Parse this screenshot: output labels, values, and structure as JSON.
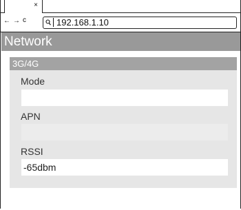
{
  "browser": {
    "tab_close_glyph": "×",
    "back_glyph": "←",
    "forward_glyph": "→",
    "reload_glyph": "c",
    "url": "192.168.1.10"
  },
  "page": {
    "title": "Network"
  },
  "panel": {
    "title": "3G/4G",
    "fields": [
      {
        "label": "Mode",
        "value": ""
      },
      {
        "label": "APN",
        "value": ""
      },
      {
        "label": "RSSI",
        "value": "-65dbm"
      }
    ]
  },
  "colors": {
    "header_bg": "#999999",
    "panel_bg": "#e6e6e6",
    "panel_header_bg": "#a3a3a3",
    "input_bg": "#ffffff",
    "disabled_input_bg": "#ececec"
  }
}
